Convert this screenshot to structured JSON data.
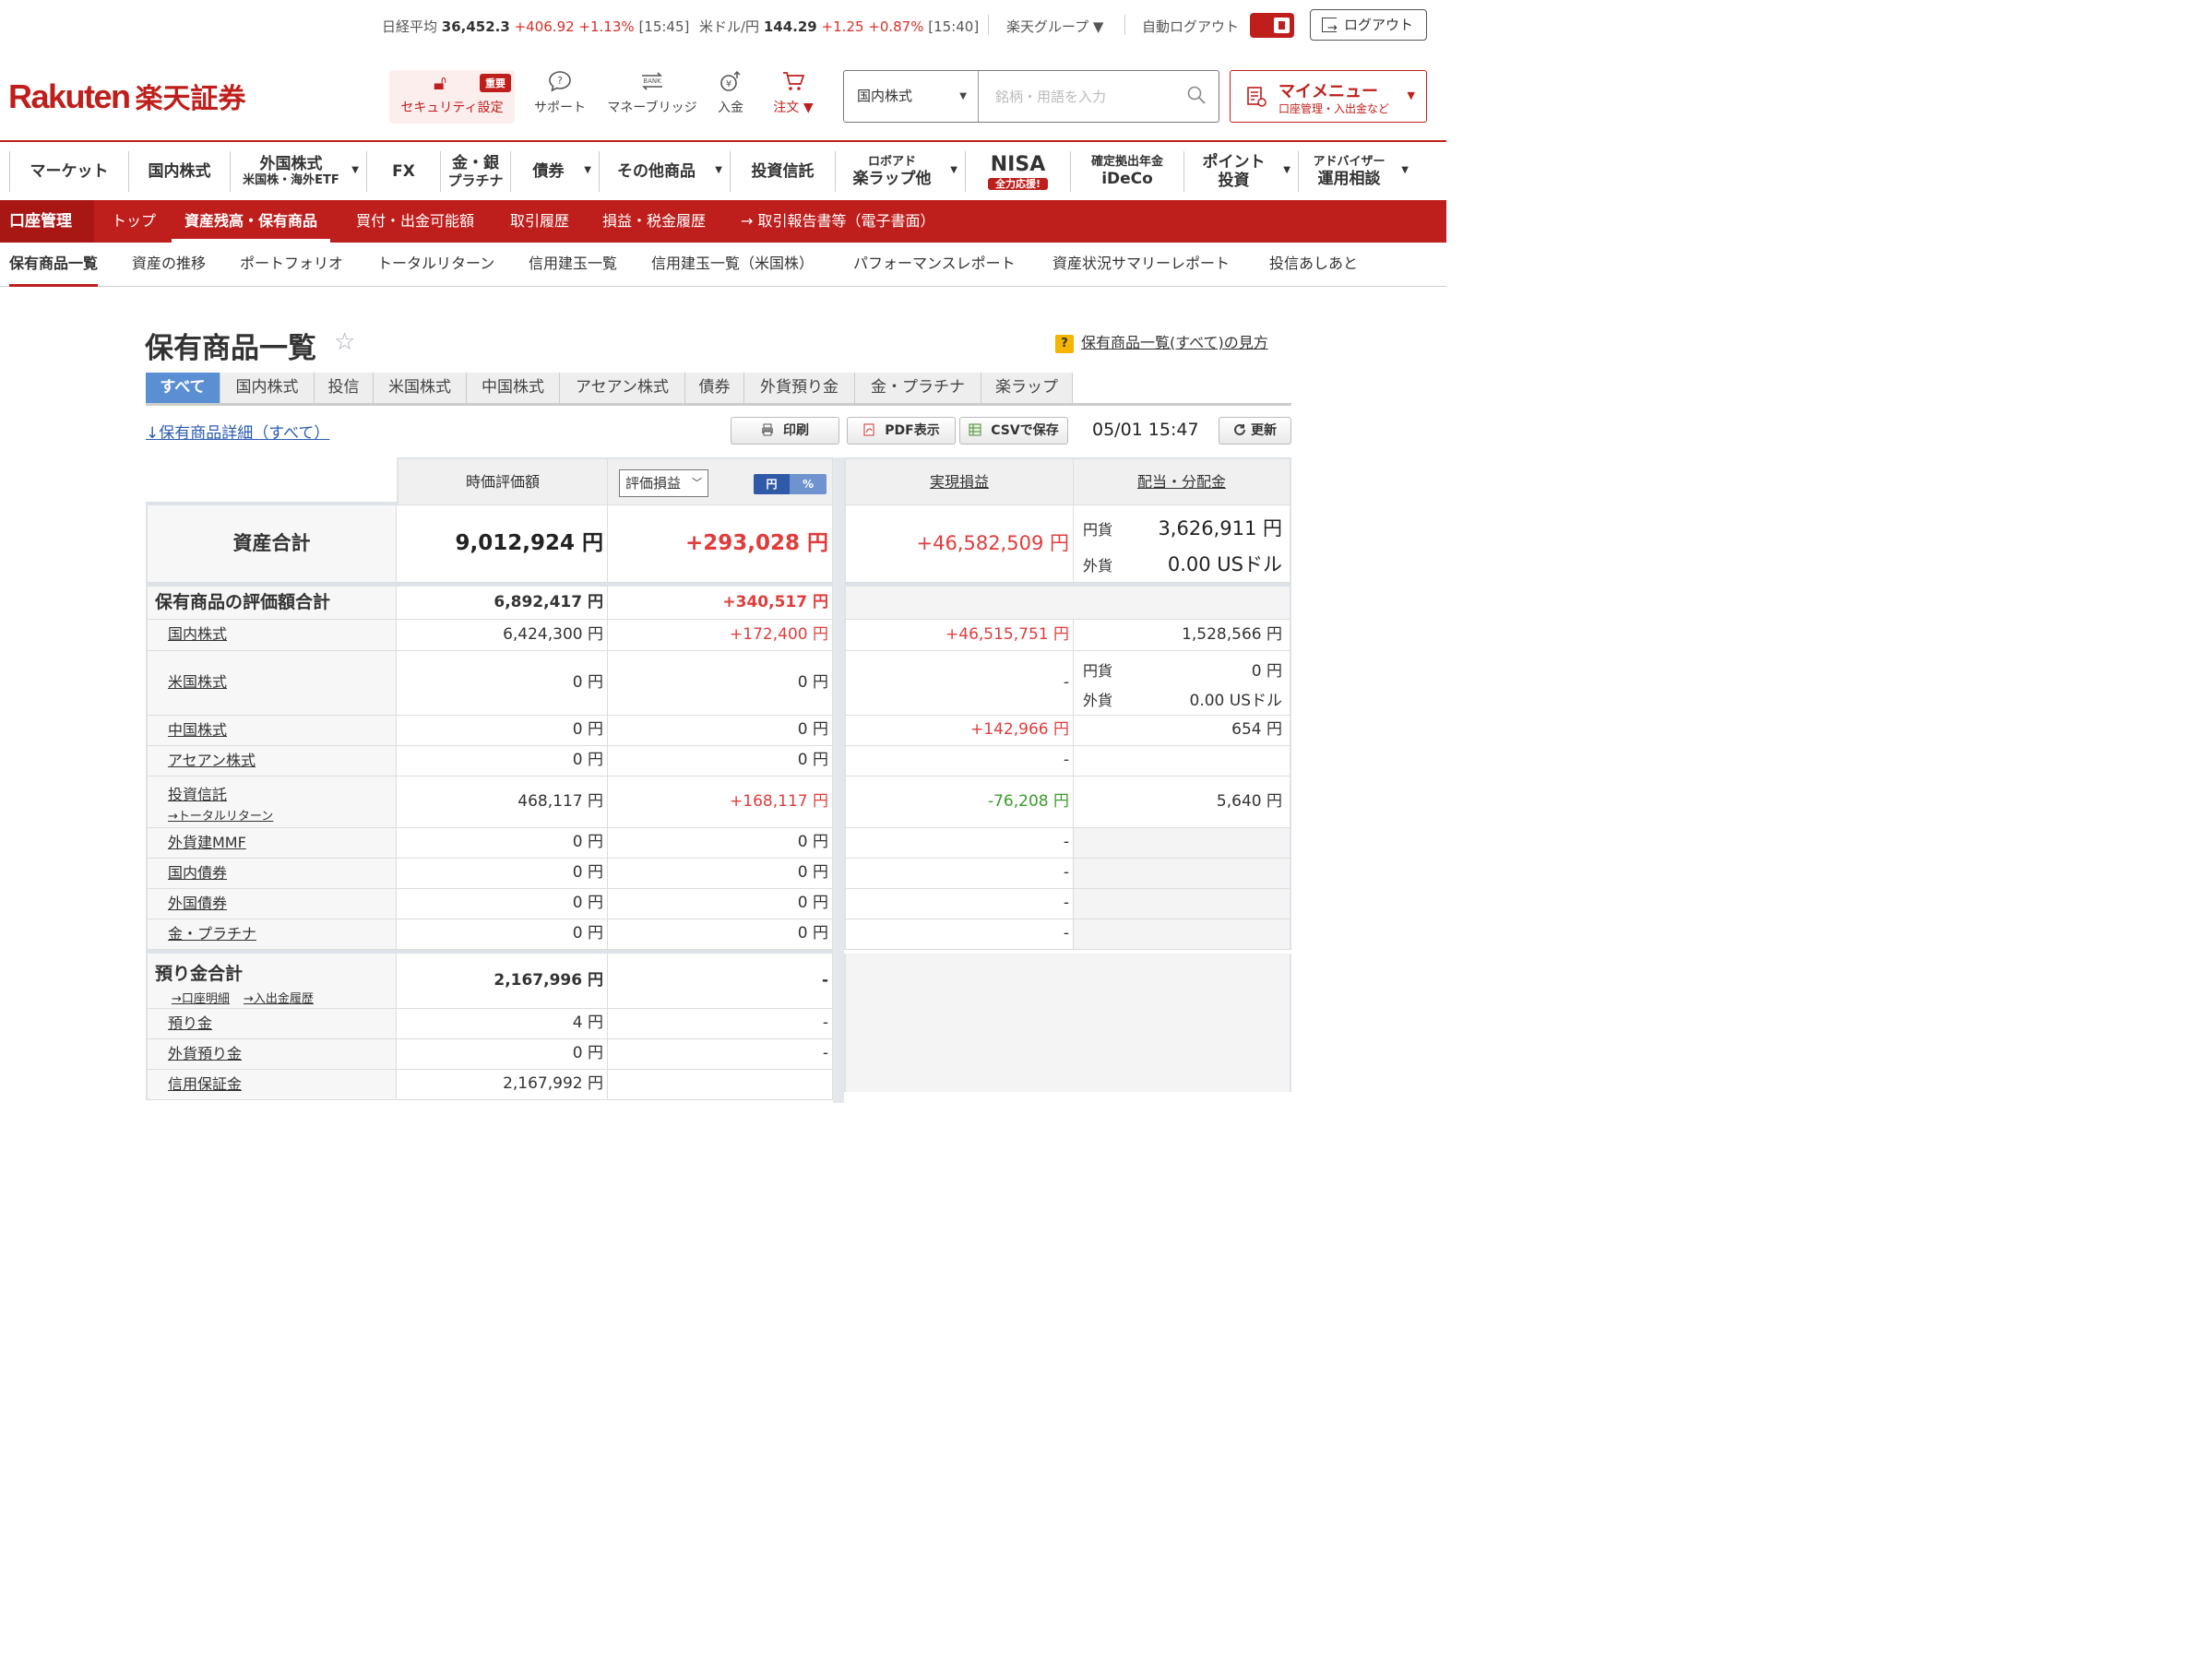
{
  "ticker": {
    "nikkei_label": "日経平均",
    "nikkei_value": "36,452.3",
    "nikkei_change": "+406.92 +1.13%",
    "nikkei_time": "[15:45]",
    "usdjpy_label": "米ドル/円",
    "usdjpy_value": "144.29",
    "usdjpy_change": "+1.25 +0.87%",
    "usdjpy_time": "[15:40]",
    "group_label": "楽天グループ ▼",
    "autologout_label": "自動ログアウト",
    "logout_label": "ログアウト"
  },
  "header": {
    "logo_en": "Rakuten",
    "logo_jp": "楽天証券",
    "security_badge": "重要",
    "security_label": "セキュリティ設定",
    "support_label": "サポート",
    "moneybridge_label": "マネーブリッジ",
    "deposit_label": "入金",
    "order_label": "注文 ▼",
    "bank_glyph": "BANK",
    "search_category": "国内株式",
    "search_placeholder": "銘柄・用語を入力",
    "mymenu_title": "マイメニュー",
    "mymenu_sub": "口座管理・入出金など"
  },
  "mainnav": [
    {
      "l1": "マーケット",
      "l2": ""
    },
    {
      "l1": "国内株式",
      "l2": ""
    },
    {
      "l1": "外国株式",
      "l2": "米国株・海外ETF"
    },
    {
      "l1": "FX",
      "l2": ""
    },
    {
      "l1": "金・銀",
      "l2": "プラチナ"
    },
    {
      "l1": "債券",
      "l2": ""
    },
    {
      "l1": "その他商品",
      "l2": ""
    },
    {
      "l1": "投資信託",
      "l2": ""
    },
    {
      "l1": "ロボアド",
      "l2": "楽ラップ他"
    },
    {
      "l1": "NISA",
      "l2": "全力応援!"
    },
    {
      "l1": "確定拠出年金",
      "l2": "iDeCo"
    },
    {
      "l1": "ポイント",
      "l2": "投資"
    },
    {
      "l1": "アドバイザー",
      "l2": "運用相談"
    }
  ],
  "redbar": {
    "label": "口座管理",
    "items": [
      "トップ",
      "資産残高・保有商品",
      "買付・出金可能額",
      "取引履歴",
      "損益・税金履歴",
      "→ 取引報告書等（電子書面）"
    ]
  },
  "subtabs": [
    "保有商品一覧",
    "資産の推移",
    "ポートフォリオ",
    "トータルリターン",
    "信用建玉一覧",
    "信用建玉一覧（米国株）",
    "パフォーマンスレポート",
    "資産状況サマリーレポート",
    "投信あしあと"
  ],
  "page": {
    "title": "保有商品一覧",
    "help_icon": "?",
    "help_link": "保有商品一覧(すべて)の見方",
    "category_tabs": [
      "すべて",
      "国内株式",
      "投信",
      "米国株式",
      "中国株式",
      "アセアン株式",
      "債券",
      "外貨預り金",
      "金・プラチナ",
      "楽ラップ"
    ],
    "detail_link": "↓保有商品詳細（すべて）",
    "print_label": "印刷",
    "pdf_label": "PDF表示",
    "csv_label": "CSVで保存",
    "timestamp": "05/01 15:47",
    "refresh_label": "更新"
  },
  "table": {
    "headers": {
      "market_value": "時価評価額",
      "unrealized_select": "評価損益",
      "toggle_yen": "円",
      "toggle_pct": "%",
      "realized": "実現損益",
      "dividend": "配当・分配金"
    },
    "total": {
      "label": "資産合計",
      "value": "9,012,924 円",
      "unrealized": "+293,028 円",
      "realized": "+46,582,509 円",
      "div_yen_label": "円貨",
      "div_yen": "3,626,911 円",
      "div_fx_label": "外貨",
      "div_fx": "0.00 USドル"
    },
    "holdings_total": {
      "label": "保有商品の評価額合計",
      "value": "6,892,417 円",
      "unrealized": "+340,517 円"
    },
    "domestic": {
      "label": "国内株式",
      "value": "6,424,300 円",
      "unrealized": "+172,400 円",
      "realized": "+46,515,751 円",
      "dividend": "1,528,566 円"
    },
    "us": {
      "label": "米国株式",
      "value": "0 円",
      "unrealized": "0 円",
      "realized": "-",
      "div_yen_label": "円貨",
      "div_yen": "0 円",
      "div_fx_label": "外貨",
      "div_fx": "0.00 USドル"
    },
    "china": {
      "label": "中国株式",
      "value": "0 円",
      "unrealized": "0 円",
      "realized": "+142,966 円",
      "dividend": "654 円"
    },
    "asean": {
      "label": "アセアン株式",
      "value": "0 円",
      "unrealized": "0 円",
      "realized": "-"
    },
    "fund": {
      "label": "投資信託",
      "sublink": "→トータルリターン",
      "value": "468,117 円",
      "unrealized": "+168,117 円",
      "realized": "-76,208 円",
      "dividend": "5,640 円"
    },
    "fxmmf": {
      "label": "外貨建MMF",
      "value": "0 円",
      "unrealized": "0 円",
      "realized": "-"
    },
    "dombond": {
      "label": "国内債券",
      "value": "0 円",
      "unrealized": "0 円",
      "realized": "-"
    },
    "forbond": {
      "label": "外国債券",
      "value": "0 円",
      "unrealized": "0 円",
      "realized": "-"
    },
    "gold": {
      "label": "金・プラチナ",
      "value": "0 円",
      "unrealized": "0 円",
      "realized": "-"
    },
    "deposit_total": {
      "label": "預り金合計",
      "link1": "→口座明細",
      "link2": "→入出金履歴",
      "value": "2,167,996 円",
      "unrealized": "-"
    },
    "deposit": {
      "label": "預り金",
      "value": "4 円",
      "unrealized": "-"
    },
    "fxdeposit": {
      "label": "外貨預り金",
      "value": "0 円",
      "unrealized": "-"
    },
    "margin": {
      "label": "信用保証金",
      "value": "2,167,992 円"
    }
  },
  "colors": {
    "brand_red": "#bf1f1c",
    "gain": "#e03c3c",
    "loss": "#3a9c2a",
    "tab_active": "#5b8fd4"
  }
}
